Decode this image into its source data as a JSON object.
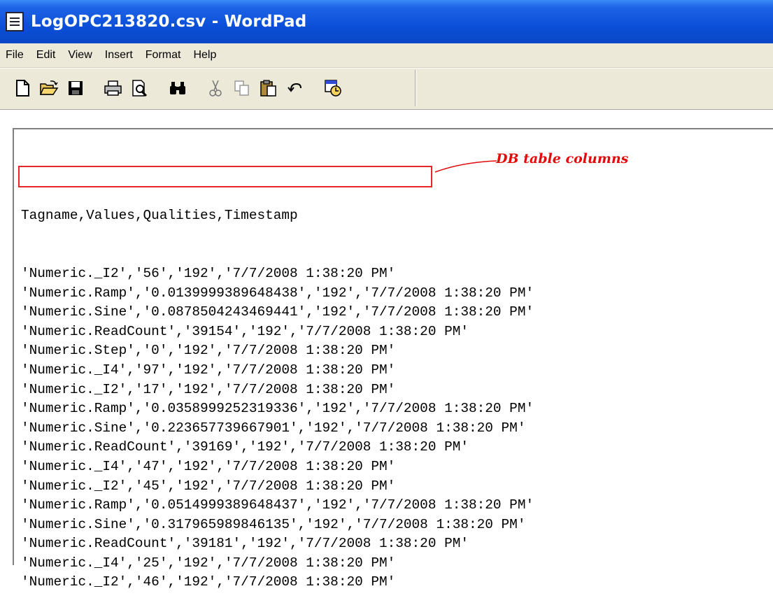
{
  "window": {
    "title": "LogOPC213820.csv - WordPad"
  },
  "menu": {
    "items": [
      "File",
      "Edit",
      "View",
      "Insert",
      "Format",
      "Help"
    ]
  },
  "toolbar": {
    "icons": [
      "new-document-icon",
      "open-folder-icon",
      "save-icon",
      "print-icon",
      "print-preview-icon",
      "find-icon",
      "cut-icon",
      "copy-icon",
      "paste-icon",
      "undo-icon",
      "date-time-icon"
    ]
  },
  "document": {
    "header_line": "Tagname,Values,Qualities,Timestamp",
    "rows": [
      "'Numeric._I2','56','192','7/7/2008 1:38:20 PM'",
      "'Numeric.Ramp','0.0139999389648438','192','7/7/2008 1:38:20 PM'",
      "'Numeric.Sine','0.0878504243469441','192','7/7/2008 1:38:20 PM'",
      "'Numeric.ReadCount','39154','192','7/7/2008 1:38:20 PM'",
      "'Numeric.Step','0','192','7/7/2008 1:38:20 PM'",
      "'Numeric._I4','97','192','7/7/2008 1:38:20 PM'",
      "'Numeric._I2','17','192','7/7/2008 1:38:20 PM'",
      "'Numeric.Ramp','0.0358999252319336','192','7/7/2008 1:38:20 PM'",
      "'Numeric.Sine','0.223657739667901','192','7/7/2008 1:38:20 PM'",
      "'Numeric.ReadCount','39169','192','7/7/2008 1:38:20 PM'",
      "'Numeric._I4','47','192','7/7/2008 1:38:20 PM'",
      "'Numeric._I2','45','192','7/7/2008 1:38:20 PM'",
      "'Numeric.Ramp','0.0514999389648437','192','7/7/2008 1:38:20 PM'",
      "'Numeric.Sine','0.317965989846135','192','7/7/2008 1:38:20 PM'",
      "'Numeric.ReadCount','39181','192','7/7/2008 1:38:20 PM'",
      "'Numeric._I4','25','192','7/7/2008 1:38:20 PM'",
      "'Numeric._I2','46','192','7/7/2008 1:38:20 PM'"
    ]
  },
  "annotation": {
    "label": "DB table columns",
    "color": "#e10b0b"
  },
  "colors": {
    "titlebar": "#0b4fd8",
    "chrome": "#ece9d8",
    "highlight_box": "#e8262a"
  }
}
